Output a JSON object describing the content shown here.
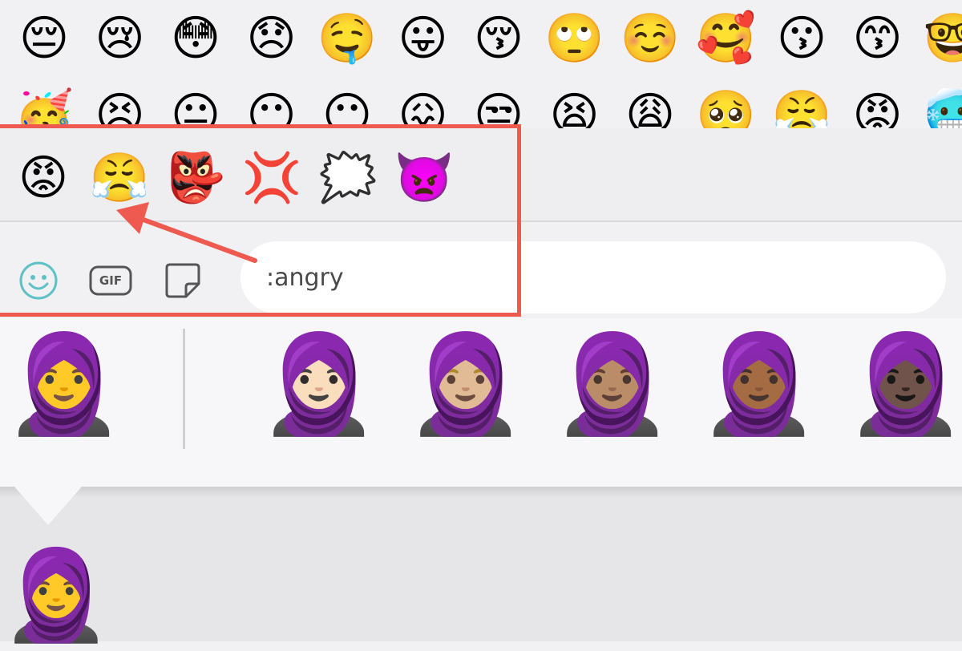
{
  "emoji_grid": {
    "row1": [
      "😔",
      "😢",
      "😳",
      "😞",
      "🤤",
      "😛",
      "😚",
      "🙄",
      "☺️",
      "🥰",
      "😗",
      "😙",
      "🤓"
    ],
    "row2": [
      "🥳",
      "😣",
      "😐",
      "😶",
      "😶",
      "😖",
      "😒",
      "😫",
      "😩",
      "🥺",
      "😤",
      "😡",
      "🥶"
    ]
  },
  "suggestions": {
    "items": [
      "😡",
      "😤",
      "👺",
      "💢",
      "🗯️",
      "👿"
    ]
  },
  "toolbar": {
    "emoji_button": "emoji",
    "gif_label": "GIF",
    "sticker_button": "sticker"
  },
  "input": {
    "value": ":angry"
  },
  "skin_tones": {
    "default": "🧕",
    "variants": [
      "🧕🏻",
      "🧕🏼",
      "🧕🏽",
      "🧕🏾",
      "🧕🏿"
    ]
  },
  "preview": {
    "emoji": "🧕"
  },
  "colors": {
    "highlight": "#ee5a4f",
    "hijab_purple": "#5b3fa6"
  }
}
